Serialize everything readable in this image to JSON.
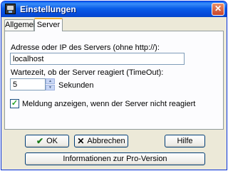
{
  "window": {
    "title": "Einstellungen",
    "close_glyph": "✕"
  },
  "tabs": [
    {
      "label": "Allgemein",
      "selected": false
    },
    {
      "label": "Server",
      "selected": true
    }
  ],
  "server": {
    "address_label": "Adresse oder IP des Servers (ohne http://):",
    "address_value": "localhost",
    "timeout_label": "Wartezeit, ob der Server reagiert (TimeOut):",
    "timeout_value": "5",
    "timeout_unit": "Sekunden",
    "notify_checkbox_label": "Meldung anzeigen, wenn der Server nicht reagiert",
    "notify_checked": true
  },
  "buttons": {
    "ok": "OK",
    "cancel": "Abbrechen",
    "help": "Hilfe",
    "pro_info": "Informationen zur Pro-Version"
  },
  "icons": {
    "ok": "checkmark-icon",
    "cancel": "x-icon",
    "app": "computer-icon"
  },
  "colors": {
    "titlebar": "#0a5de8",
    "dialog_bg": "#ece9d8",
    "panel_bg": "#fcfcfe",
    "active_tab_accent": "#f0b63b"
  }
}
